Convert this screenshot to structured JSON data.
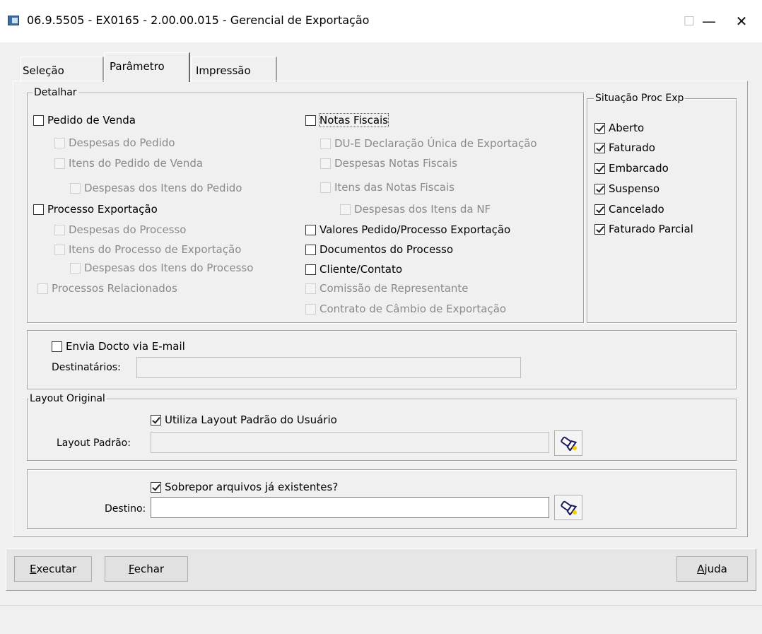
{
  "window": {
    "title": "06.9.5505 - EX0165 - 2.00.00.015 - Gerencial de Exportação",
    "minimize": "—",
    "maximize": "☐",
    "close": "✕"
  },
  "tabs": [
    {
      "label": "Seleção",
      "active": false
    },
    {
      "label": "Parâmetro",
      "active": true
    },
    {
      "label": "Impressão",
      "active": false
    }
  ],
  "detalhar": {
    "title": "Detalhar",
    "left": [
      {
        "label": "Pedido de Venda",
        "checked": false,
        "enabled": true
      },
      {
        "label": "Despesas do Pedido",
        "checked": false,
        "enabled": false
      },
      {
        "label": "Itens do Pedido de Venda",
        "checked": false,
        "enabled": false
      },
      {
        "label": "Despesas dos Itens do Pedido",
        "checked": false,
        "enabled": false
      },
      {
        "label": "Processo Exportação",
        "checked": false,
        "enabled": true
      },
      {
        "label": "Despesas do Processo",
        "checked": false,
        "enabled": false
      },
      {
        "label": "Itens do Processo de Exportação",
        "checked": false,
        "enabled": false
      },
      {
        "label": "Despesas dos Itens do Processo",
        "checked": false,
        "enabled": false
      },
      {
        "label": "Processos Relacionados",
        "checked": false,
        "enabled": false
      }
    ],
    "right": [
      {
        "label": "Notas Fiscais",
        "checked": false,
        "enabled": true
      },
      {
        "label": "DU-E Declaração Única de Exportação",
        "checked": false,
        "enabled": false
      },
      {
        "label": "Despesas Notas Fiscais",
        "checked": false,
        "enabled": false
      },
      {
        "label": "Itens das Notas Fiscais",
        "checked": false,
        "enabled": false
      },
      {
        "label": "Despesas dos Itens da NF",
        "checked": false,
        "enabled": false
      },
      {
        "label": "Valores Pedido/Processo Exportação",
        "checked": false,
        "enabled": true
      },
      {
        "label": "Documentos do Processo",
        "checked": false,
        "enabled": true
      },
      {
        "label": "Cliente/Contato",
        "checked": false,
        "enabled": true
      },
      {
        "label": "Comissão de Representante",
        "checked": false,
        "enabled": false
      },
      {
        "label": "Contrato de Câmbio de Exportação",
        "checked": false,
        "enabled": false
      }
    ]
  },
  "situacao": {
    "title": "Situação Proc Exp",
    "items": [
      {
        "label": "Aberto",
        "checked": true
      },
      {
        "label": "Faturado",
        "checked": true
      },
      {
        "label": "Embarcado",
        "checked": true
      },
      {
        "label": "Suspenso",
        "checked": true
      },
      {
        "label": "Cancelado",
        "checked": true
      },
      {
        "label": "Faturado Parcial",
        "checked": true
      }
    ]
  },
  "email": {
    "checkbox_label": "Envia Docto via E-mail",
    "checked": false,
    "destinatarios_label": "Destinatários:",
    "destinatarios_value": ""
  },
  "layout": {
    "title": "Layout Original",
    "checkbox_label": "Utiliza Layout Padrão do Usuário",
    "checked": true,
    "field_label": "Layout Padrão:",
    "field_value": ""
  },
  "destino": {
    "checkbox_label": "Sobrepor arquivos já existentes?",
    "checked": true,
    "field_label": "Destino:",
    "field_value": ""
  },
  "buttons": {
    "executar": "Executar",
    "fechar": "Fechar",
    "ajuda": "Ajuda"
  }
}
